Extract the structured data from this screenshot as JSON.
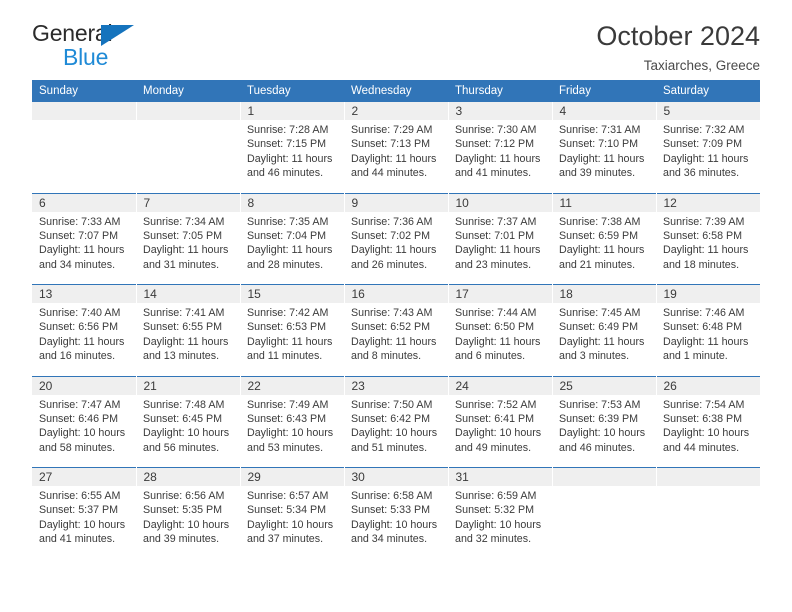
{
  "logo": {
    "word_one": "General",
    "word_two": "Blue",
    "triangle_color": "#1573bd",
    "blue_text_color": "#1f8ad6"
  },
  "header": {
    "title": "October 2024",
    "subtitle": "Taxiarches, Greece"
  },
  "theme": {
    "header_blue": "#3175b8",
    "daynum_band": "#efefef",
    "text": "#3b3b3b"
  },
  "calendar": {
    "weekday_headers": [
      "Sunday",
      "Monday",
      "Tuesday",
      "Wednesday",
      "Thursday",
      "Friday",
      "Saturday"
    ],
    "weeks": [
      [
        {
          "day": "",
          "lines": []
        },
        {
          "day": "",
          "lines": []
        },
        {
          "day": "1",
          "lines": [
            "Sunrise: 7:28 AM",
            "Sunset: 7:15 PM",
            "Daylight: 11 hours",
            "and 46 minutes."
          ]
        },
        {
          "day": "2",
          "lines": [
            "Sunrise: 7:29 AM",
            "Sunset: 7:13 PM",
            "Daylight: 11 hours",
            "and 44 minutes."
          ]
        },
        {
          "day": "3",
          "lines": [
            "Sunrise: 7:30 AM",
            "Sunset: 7:12 PM",
            "Daylight: 11 hours",
            "and 41 minutes."
          ]
        },
        {
          "day": "4",
          "lines": [
            "Sunrise: 7:31 AM",
            "Sunset: 7:10 PM",
            "Daylight: 11 hours",
            "and 39 minutes."
          ]
        },
        {
          "day": "5",
          "lines": [
            "Sunrise: 7:32 AM",
            "Sunset: 7:09 PM",
            "Daylight: 11 hours",
            "and 36 minutes."
          ]
        }
      ],
      [
        {
          "day": "6",
          "lines": [
            "Sunrise: 7:33 AM",
            "Sunset: 7:07 PM",
            "Daylight: 11 hours",
            "and 34 minutes."
          ]
        },
        {
          "day": "7",
          "lines": [
            "Sunrise: 7:34 AM",
            "Sunset: 7:05 PM",
            "Daylight: 11 hours",
            "and 31 minutes."
          ]
        },
        {
          "day": "8",
          "lines": [
            "Sunrise: 7:35 AM",
            "Sunset: 7:04 PM",
            "Daylight: 11 hours",
            "and 28 minutes."
          ]
        },
        {
          "day": "9",
          "lines": [
            "Sunrise: 7:36 AM",
            "Sunset: 7:02 PM",
            "Daylight: 11 hours",
            "and 26 minutes."
          ]
        },
        {
          "day": "10",
          "lines": [
            "Sunrise: 7:37 AM",
            "Sunset: 7:01 PM",
            "Daylight: 11 hours",
            "and 23 minutes."
          ]
        },
        {
          "day": "11",
          "lines": [
            "Sunrise: 7:38 AM",
            "Sunset: 6:59 PM",
            "Daylight: 11 hours",
            "and 21 minutes."
          ]
        },
        {
          "day": "12",
          "lines": [
            "Sunrise: 7:39 AM",
            "Sunset: 6:58 PM",
            "Daylight: 11 hours",
            "and 18 minutes."
          ]
        }
      ],
      [
        {
          "day": "13",
          "lines": [
            "Sunrise: 7:40 AM",
            "Sunset: 6:56 PM",
            "Daylight: 11 hours",
            "and 16 minutes."
          ]
        },
        {
          "day": "14",
          "lines": [
            "Sunrise: 7:41 AM",
            "Sunset: 6:55 PM",
            "Daylight: 11 hours",
            "and 13 minutes."
          ]
        },
        {
          "day": "15",
          "lines": [
            "Sunrise: 7:42 AM",
            "Sunset: 6:53 PM",
            "Daylight: 11 hours",
            "and 11 minutes."
          ]
        },
        {
          "day": "16",
          "lines": [
            "Sunrise: 7:43 AM",
            "Sunset: 6:52 PM",
            "Daylight: 11 hours",
            "and 8 minutes."
          ]
        },
        {
          "day": "17",
          "lines": [
            "Sunrise: 7:44 AM",
            "Sunset: 6:50 PM",
            "Daylight: 11 hours",
            "and 6 minutes."
          ]
        },
        {
          "day": "18",
          "lines": [
            "Sunrise: 7:45 AM",
            "Sunset: 6:49 PM",
            "Daylight: 11 hours",
            "and 3 minutes."
          ]
        },
        {
          "day": "19",
          "lines": [
            "Sunrise: 7:46 AM",
            "Sunset: 6:48 PM",
            "Daylight: 11 hours",
            "and 1 minute."
          ]
        }
      ],
      [
        {
          "day": "20",
          "lines": [
            "Sunrise: 7:47 AM",
            "Sunset: 6:46 PM",
            "Daylight: 10 hours",
            "and 58 minutes."
          ]
        },
        {
          "day": "21",
          "lines": [
            "Sunrise: 7:48 AM",
            "Sunset: 6:45 PM",
            "Daylight: 10 hours",
            "and 56 minutes."
          ]
        },
        {
          "day": "22",
          "lines": [
            "Sunrise: 7:49 AM",
            "Sunset: 6:43 PM",
            "Daylight: 10 hours",
            "and 53 minutes."
          ]
        },
        {
          "day": "23",
          "lines": [
            "Sunrise: 7:50 AM",
            "Sunset: 6:42 PM",
            "Daylight: 10 hours",
            "and 51 minutes."
          ]
        },
        {
          "day": "24",
          "lines": [
            "Sunrise: 7:52 AM",
            "Sunset: 6:41 PM",
            "Daylight: 10 hours",
            "and 49 minutes."
          ]
        },
        {
          "day": "25",
          "lines": [
            "Sunrise: 7:53 AM",
            "Sunset: 6:39 PM",
            "Daylight: 10 hours",
            "and 46 minutes."
          ]
        },
        {
          "day": "26",
          "lines": [
            "Sunrise: 7:54 AM",
            "Sunset: 6:38 PM",
            "Daylight: 10 hours",
            "and 44 minutes."
          ]
        }
      ],
      [
        {
          "day": "27",
          "lines": [
            "Sunrise: 6:55 AM",
            "Sunset: 5:37 PM",
            "Daylight: 10 hours",
            "and 41 minutes."
          ]
        },
        {
          "day": "28",
          "lines": [
            "Sunrise: 6:56 AM",
            "Sunset: 5:35 PM",
            "Daylight: 10 hours",
            "and 39 minutes."
          ]
        },
        {
          "day": "29",
          "lines": [
            "Sunrise: 6:57 AM",
            "Sunset: 5:34 PM",
            "Daylight: 10 hours",
            "and 37 minutes."
          ]
        },
        {
          "day": "30",
          "lines": [
            "Sunrise: 6:58 AM",
            "Sunset: 5:33 PM",
            "Daylight: 10 hours",
            "and 34 minutes."
          ]
        },
        {
          "day": "31",
          "lines": [
            "Sunrise: 6:59 AM",
            "Sunset: 5:32 PM",
            "Daylight: 10 hours",
            "and 32 minutes."
          ]
        },
        {
          "day": "",
          "lines": []
        },
        {
          "day": "",
          "lines": []
        }
      ]
    ]
  }
}
